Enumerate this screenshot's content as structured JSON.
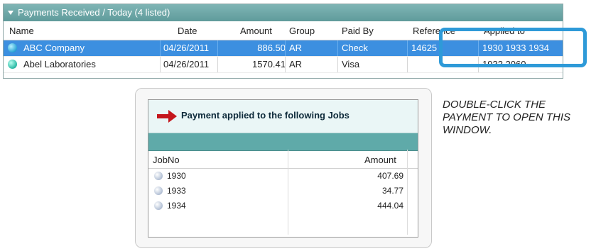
{
  "panel": {
    "title": "Payments Received / Today (4 listed)",
    "columns": [
      "Name",
      "Date",
      "Amount",
      "Group",
      "Paid By",
      "Reference",
      "Applied to"
    ],
    "rows": [
      {
        "name": "ABC Company",
        "date": "04/26/2011",
        "amount": "886.50",
        "group": "AR",
        "paid_by": "Check",
        "reference": "14625",
        "applied_to": "1930 1933 1934",
        "selected": true
      },
      {
        "name": "Abel Laboratories",
        "date": "04/26/2011",
        "amount": "1570.41",
        "group": "AR",
        "paid_by": "Visa",
        "reference": "",
        "applied_to": "1932 2060",
        "selected": false
      }
    ]
  },
  "popup": {
    "title": "Payment applied to the following Jobs",
    "columns": [
      "JobNo",
      "Amount"
    ],
    "rows": [
      {
        "job": "1930",
        "amount": "407.69"
      },
      {
        "job": "1933",
        "amount": "34.77"
      },
      {
        "job": "1934",
        "amount": "444.04"
      }
    ]
  },
  "note": "Double-click the payment to open this window.",
  "colors": {
    "accent": "#5faaa9",
    "selection": "#3c8fe0",
    "callout": "#2e9ad8",
    "arrow": "#c4161c"
  }
}
